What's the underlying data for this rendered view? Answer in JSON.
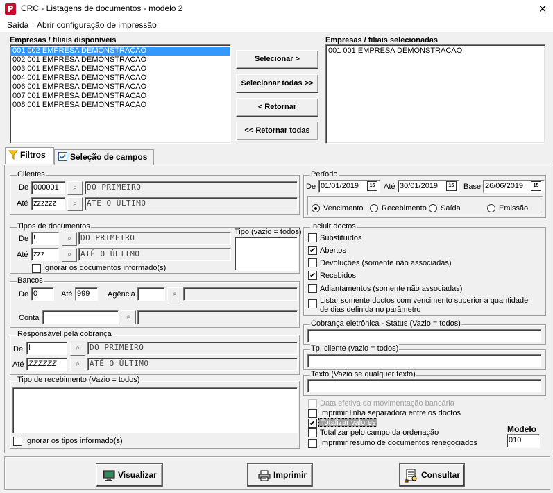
{
  "window": {
    "title": "CRC - Listagens de documentos - modelo 2",
    "app_icon": "P",
    "close": "✕"
  },
  "menu": {
    "items": [
      "Saída",
      "Abrir configuração de impressão"
    ]
  },
  "empresas": {
    "available_title": "Empresas / filiais disponíveis",
    "selected_title": "Empresas / filiais selecionadas",
    "available": [
      "001 002 EMPRESA DEMONSTRACAO",
      "002 001 EMPRESA DEMONSTRACAO",
      "003 001 EMPRESA DEMONSTRACAO",
      "004 001 EMPRESA DEMONSTRACAO",
      "006 001 EMPRESA DEMONSTRACAO",
      "007 001 EMPRESA DEMONSTRACAO",
      "008 001 EMPRESA DEMONSTRACAO"
    ],
    "selected": [
      "001 001 EMPRESA DEMONSTRACAO"
    ],
    "buttons": {
      "select": "Selecionar >",
      "select_all": "Selecionar todas >>",
      "back": "< Retornar",
      "back_all": "<< Retornar todas"
    }
  },
  "tabs": {
    "filters": "Filtros",
    "fields": "Seleção de campos"
  },
  "clientes": {
    "title": "Clientes",
    "de_label": "De",
    "ate_label": "Até",
    "de_value": "000001",
    "ate_value": "zzzzzz",
    "de_desc": "DO PRIMEIRO",
    "ate_desc": "ATÉ O ÚLTIMO"
  },
  "periodo": {
    "title": "Período",
    "de_label": "De",
    "de_value": "01/01/2019",
    "ate_label": "Até",
    "ate_value": "30/01/2019",
    "base_label": "Base",
    "base_value": "26/06/2019",
    "cal_icon": "15",
    "options": [
      "Vencimento",
      "Recebimento",
      "Saída",
      "Emissão"
    ],
    "selected": "Vencimento"
  },
  "tipos_doc": {
    "title": "Tipos de documentos",
    "de_label": "De",
    "ate_label": "Até",
    "de_value": "!",
    "ate_value": "zzz",
    "de_desc": "DO PRIMEIRO",
    "ate_desc": "ATÉ O ÚLTIMO",
    "tipo_label": "Tipo (vazio = todos)",
    "ignore_label": "Ignorar os documentos informado(s)",
    "ignore_checked": false
  },
  "incluir": {
    "title": "Incluir doctos",
    "items": [
      {
        "label": "Substituídos",
        "checked": false
      },
      {
        "label": "Abertos",
        "checked": true
      },
      {
        "label": "Devoluções (somente não associadas)",
        "checked": false
      },
      {
        "label": "Recebidos",
        "checked": true
      },
      {
        "label": "Adiantamentos (somente não associadas)",
        "checked": false
      },
      {
        "label": "Listar somente doctos com vencimento superior a quantidade",
        "checked": false
      }
    ],
    "extra_line": "de dias definida no parâmetro"
  },
  "bancos": {
    "title": "Bancos",
    "de_label": "De",
    "de_value": "0",
    "ate_label": "Até",
    "ate_value": "999",
    "agencia_label": "Agência",
    "agencia_value": "",
    "conta_label": "Conta",
    "conta_value": ""
  },
  "cobranca": {
    "title": "Cobrança eletrônica - Status (Vazio = todos)",
    "value": ""
  },
  "responsavel": {
    "title": "Responsável pela cobrança",
    "de_label": "De",
    "ate_label": "Até",
    "de_value": "!",
    "ate_value": "ZZZZZZ",
    "de_desc": "DO PRIMEIRO",
    "ate_desc": "ATÉ O ÚLTIMO"
  },
  "tp_cliente": {
    "title": "Tp. cliente (vazio = todos)",
    "value": ""
  },
  "texto": {
    "title": "Texto (Vazio se qualquer texto)",
    "value": ""
  },
  "tipo_receb": {
    "title": "Tipo de recebimento (Vazio = todos)",
    "ignore_label": "Ignorar os tipos informado(s)",
    "ignore_checked": false
  },
  "opcoes": {
    "items": [
      {
        "label": "Data efetiva da movimentação bancária",
        "checked": false,
        "disabled": true
      },
      {
        "label": "Imprimir linha separadora entre os doctos",
        "checked": false,
        "disabled": false
      },
      {
        "label": "Totalizar valores",
        "checked": true,
        "disabled": false,
        "highlighted": true
      },
      {
        "label": "Totalizar pelo campo da ordenação",
        "checked": false,
        "disabled": false
      },
      {
        "label": "Imprimir resumo de documentos renegociados",
        "checked": false,
        "disabled": false
      }
    ]
  },
  "modelo": {
    "label": "Modelo",
    "value": "010"
  },
  "actions": {
    "visualizar": "Visualizar",
    "imprimir": "Imprimir",
    "consultar": "Consultar"
  },
  "lookup_icon": "binoculars-icon"
}
